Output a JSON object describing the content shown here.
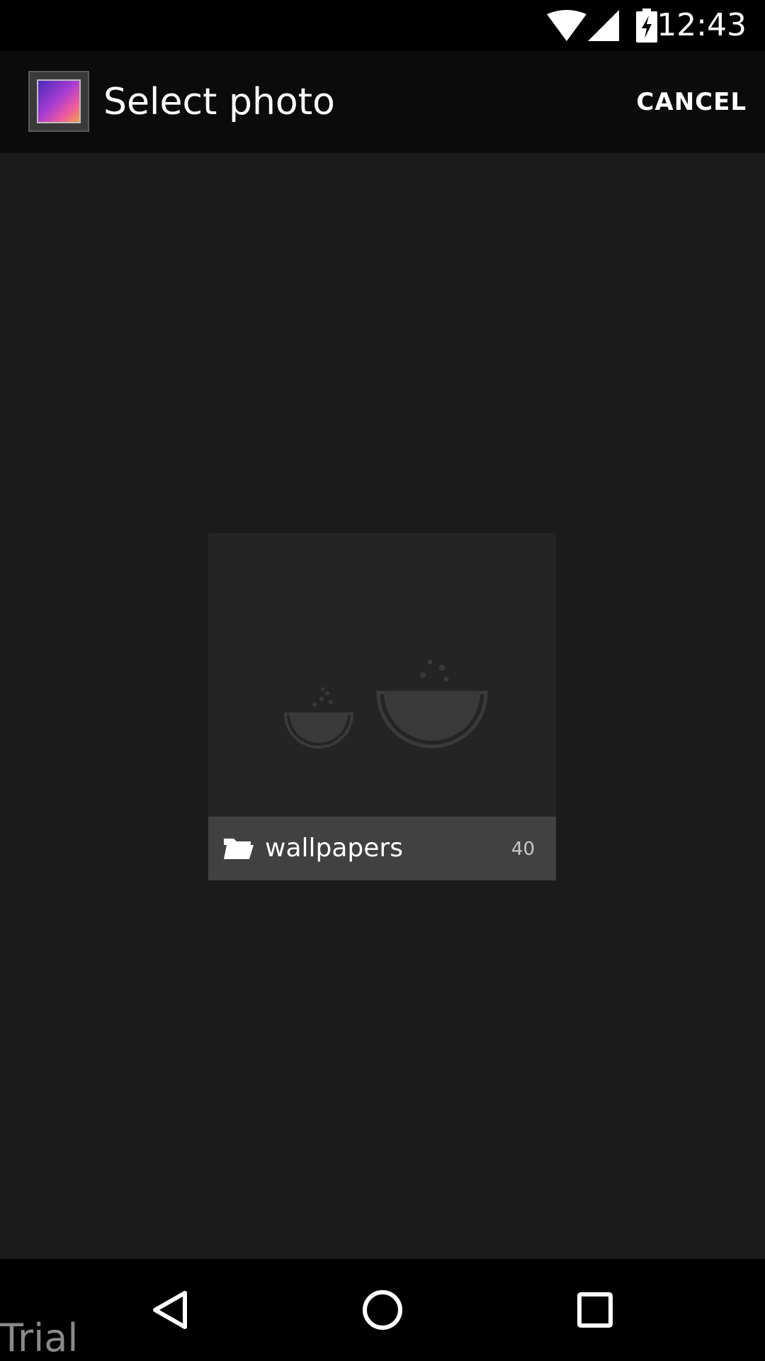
{
  "status_bar": {
    "time": "12:43",
    "icons": [
      "wifi-icon",
      "cell-signal-icon",
      "battery-charging-icon"
    ]
  },
  "action_bar": {
    "app_icon": "gallery-icon",
    "title": "Select photo",
    "cancel_label": "CANCEL"
  },
  "albums": [
    {
      "name": "wallpapers",
      "count": "40",
      "icon": "folder-icon",
      "thumbnail_icon": "watermelon-icon"
    }
  ],
  "nav_bar": {
    "buttons": [
      "back-icon",
      "home-icon",
      "recent-apps-icon"
    ]
  },
  "watermark": "Trial",
  "colors": {
    "background": "#1b1b1b",
    "action_bar": "#0b0b0b",
    "album_label_bg": "#414142",
    "status_bar": "#000000"
  }
}
